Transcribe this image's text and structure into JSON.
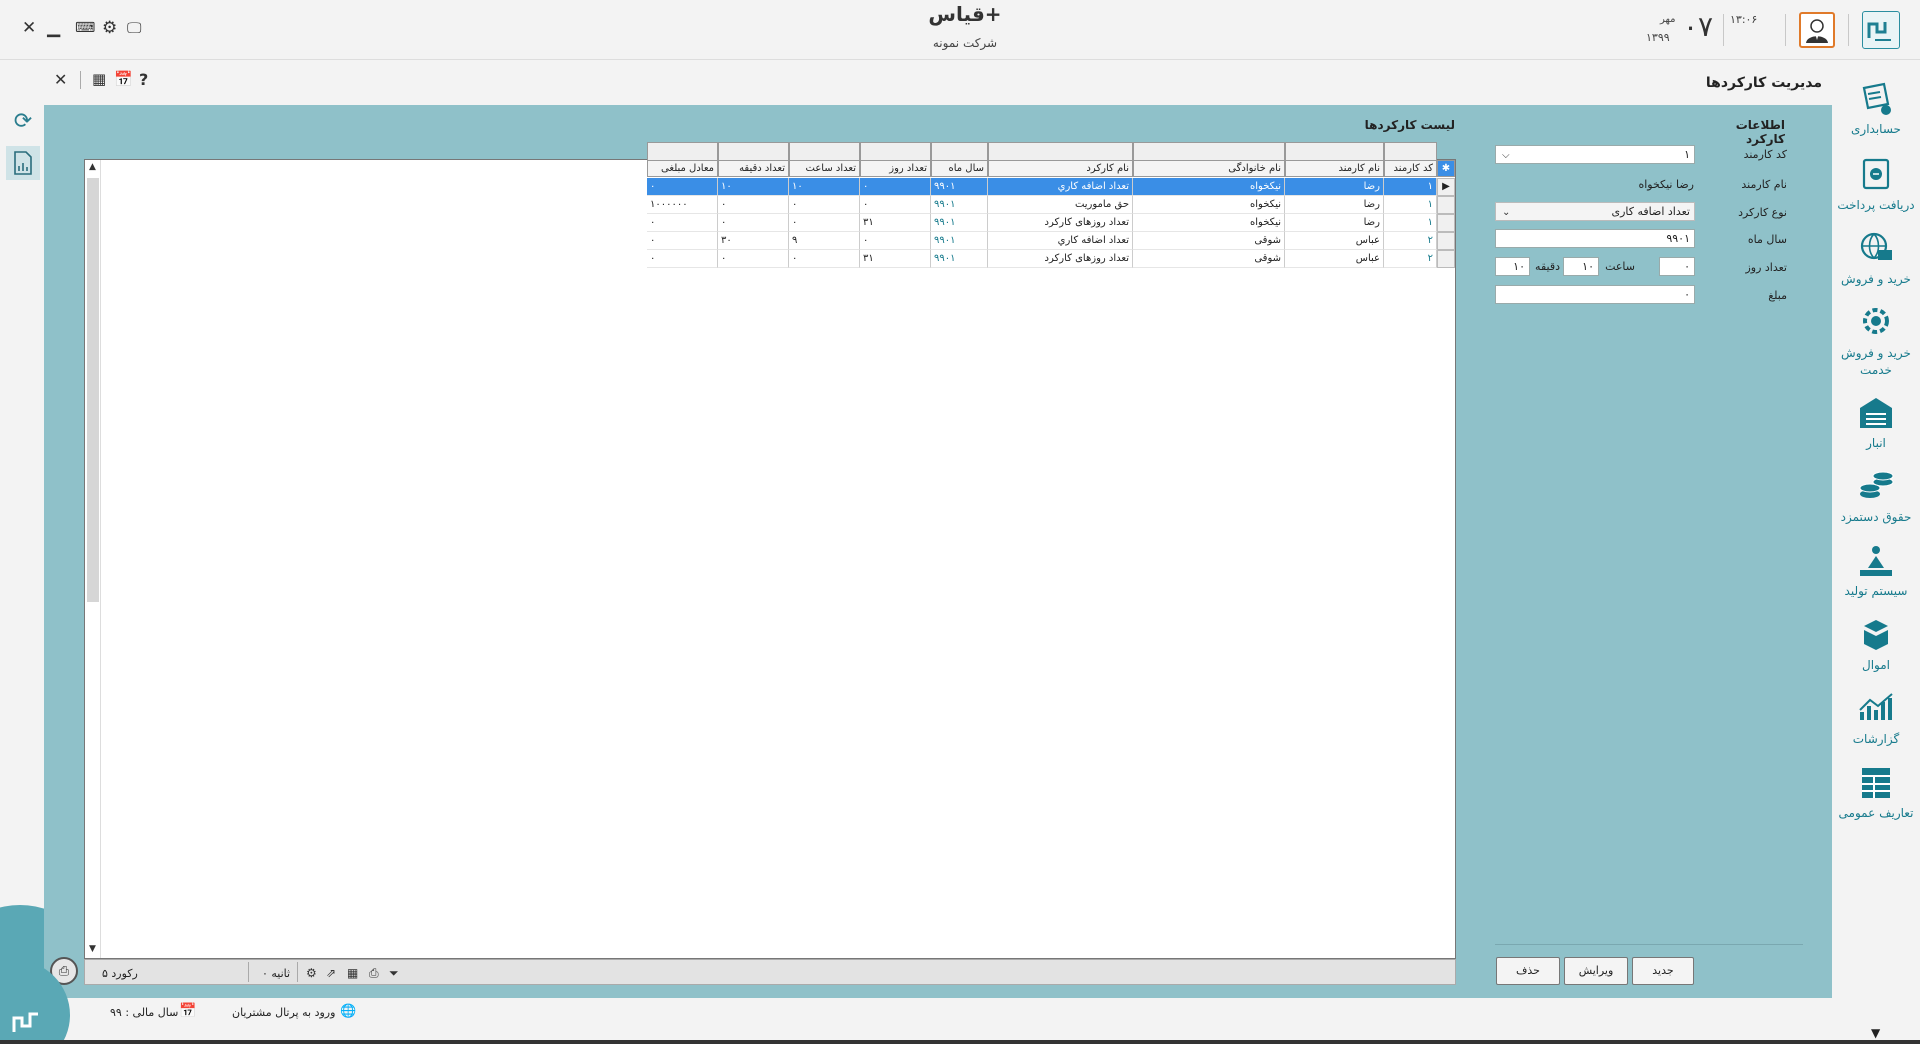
{
  "header": {
    "app_title": "قیاس+",
    "company": "شرکت نمونه",
    "time": "۱۳:۰۶",
    "day": "۰۷",
    "month": "مهر",
    "year": "۱۳۹۹"
  },
  "page": {
    "title": "مدیریت کارکردها"
  },
  "sidebar": {
    "items": [
      {
        "label": "حسابداری",
        "icon": "accounting-icon"
      },
      {
        "label": "دریافت پرداخت",
        "icon": "payment-icon"
      },
      {
        "label": "خرید و فروش",
        "icon": "globe-cart-icon"
      },
      {
        "label": "خرید و فروش خدمت",
        "icon": "service-gear-icon"
      },
      {
        "label": "انبار",
        "icon": "warehouse-icon"
      },
      {
        "label": "حقوق دستمزد",
        "icon": "coins-icon"
      },
      {
        "label": "سیستم تولید",
        "icon": "production-icon"
      },
      {
        "label": "اموال",
        "icon": "box-icon"
      },
      {
        "label": "گزارشات",
        "icon": "chart-icon"
      },
      {
        "label": "تعاریف عمومی",
        "icon": "table-icon"
      }
    ]
  },
  "form": {
    "title": "اطلاعات کارکرد",
    "employee_code_label": "کد کارمند",
    "employee_code_value": "۱",
    "employee_name_label": "نام کارمند",
    "employee_name_value": "رضا نیکخواه",
    "work_type_label": "نوع کارکرد",
    "work_type_value": "تعداد اضافه کاری",
    "year_month_label": "سال ماه",
    "year_month_value": "۹۹۰۱",
    "days_label": "تعداد روز",
    "days_value": "۰",
    "hours_label": "ساعت",
    "hours_value": "۱۰",
    "minutes_label": "دقیقه",
    "minutes_value": "۱۰",
    "amount_label": "مبلغ",
    "amount_value": "۰"
  },
  "list": {
    "title": "لیست کارکردها",
    "columns": [
      "کد کارمند",
      "نام کارمند",
      "نام خانوادگی",
      "نام کارکرد",
      "سال ماه",
      "تعداد روز",
      "تعداد ساعت",
      "تعداد دقیقه",
      "معادل مبلغی"
    ],
    "rows": [
      [
        "۱",
        "رضا",
        "نیکخواه",
        "تعداد اضافه کاري",
        "۹۹۰۱",
        "۰",
        "۱۰",
        "۱۰",
        "۰"
      ],
      [
        "۱",
        "رضا",
        "نیکخواه",
        "حق ماموریت",
        "۹۹۰۱",
        "۰",
        "۰",
        "۰",
        "۱۰۰۰۰۰۰"
      ],
      [
        "۱",
        "رضا",
        "نیکخواه",
        "تعداد روزهای کارکرد",
        "۹۹۰۱",
        "۳۱",
        "۰",
        "۰",
        "۰"
      ],
      [
        "۲",
        "عباس",
        "شوقی",
        "تعداد اضافه کاري",
        "۹۹۰۱",
        "۰",
        "۹",
        "۳۰",
        "۰"
      ],
      [
        "۲",
        "عباس",
        "شوقی",
        "تعداد روزهای کارکرد",
        "۹۹۰۱",
        "۳۱",
        "۰",
        "۰",
        "۰"
      ]
    ],
    "record_count": "۵ رکورد",
    "seconds": "۰ ثانیه"
  },
  "buttons": {
    "new": "جدید",
    "edit": "ویرایش",
    "delete": "حذف"
  },
  "status": {
    "portal": "ورود به پرتال مشتریان",
    "fiscal_year": "سال مالی : ۹۹"
  },
  "colors": {
    "teal_bg": "#8fc1c9",
    "accent": "#167a8c",
    "selected_row": "#3a8ee6",
    "avatar_border": "#e07a2a"
  }
}
